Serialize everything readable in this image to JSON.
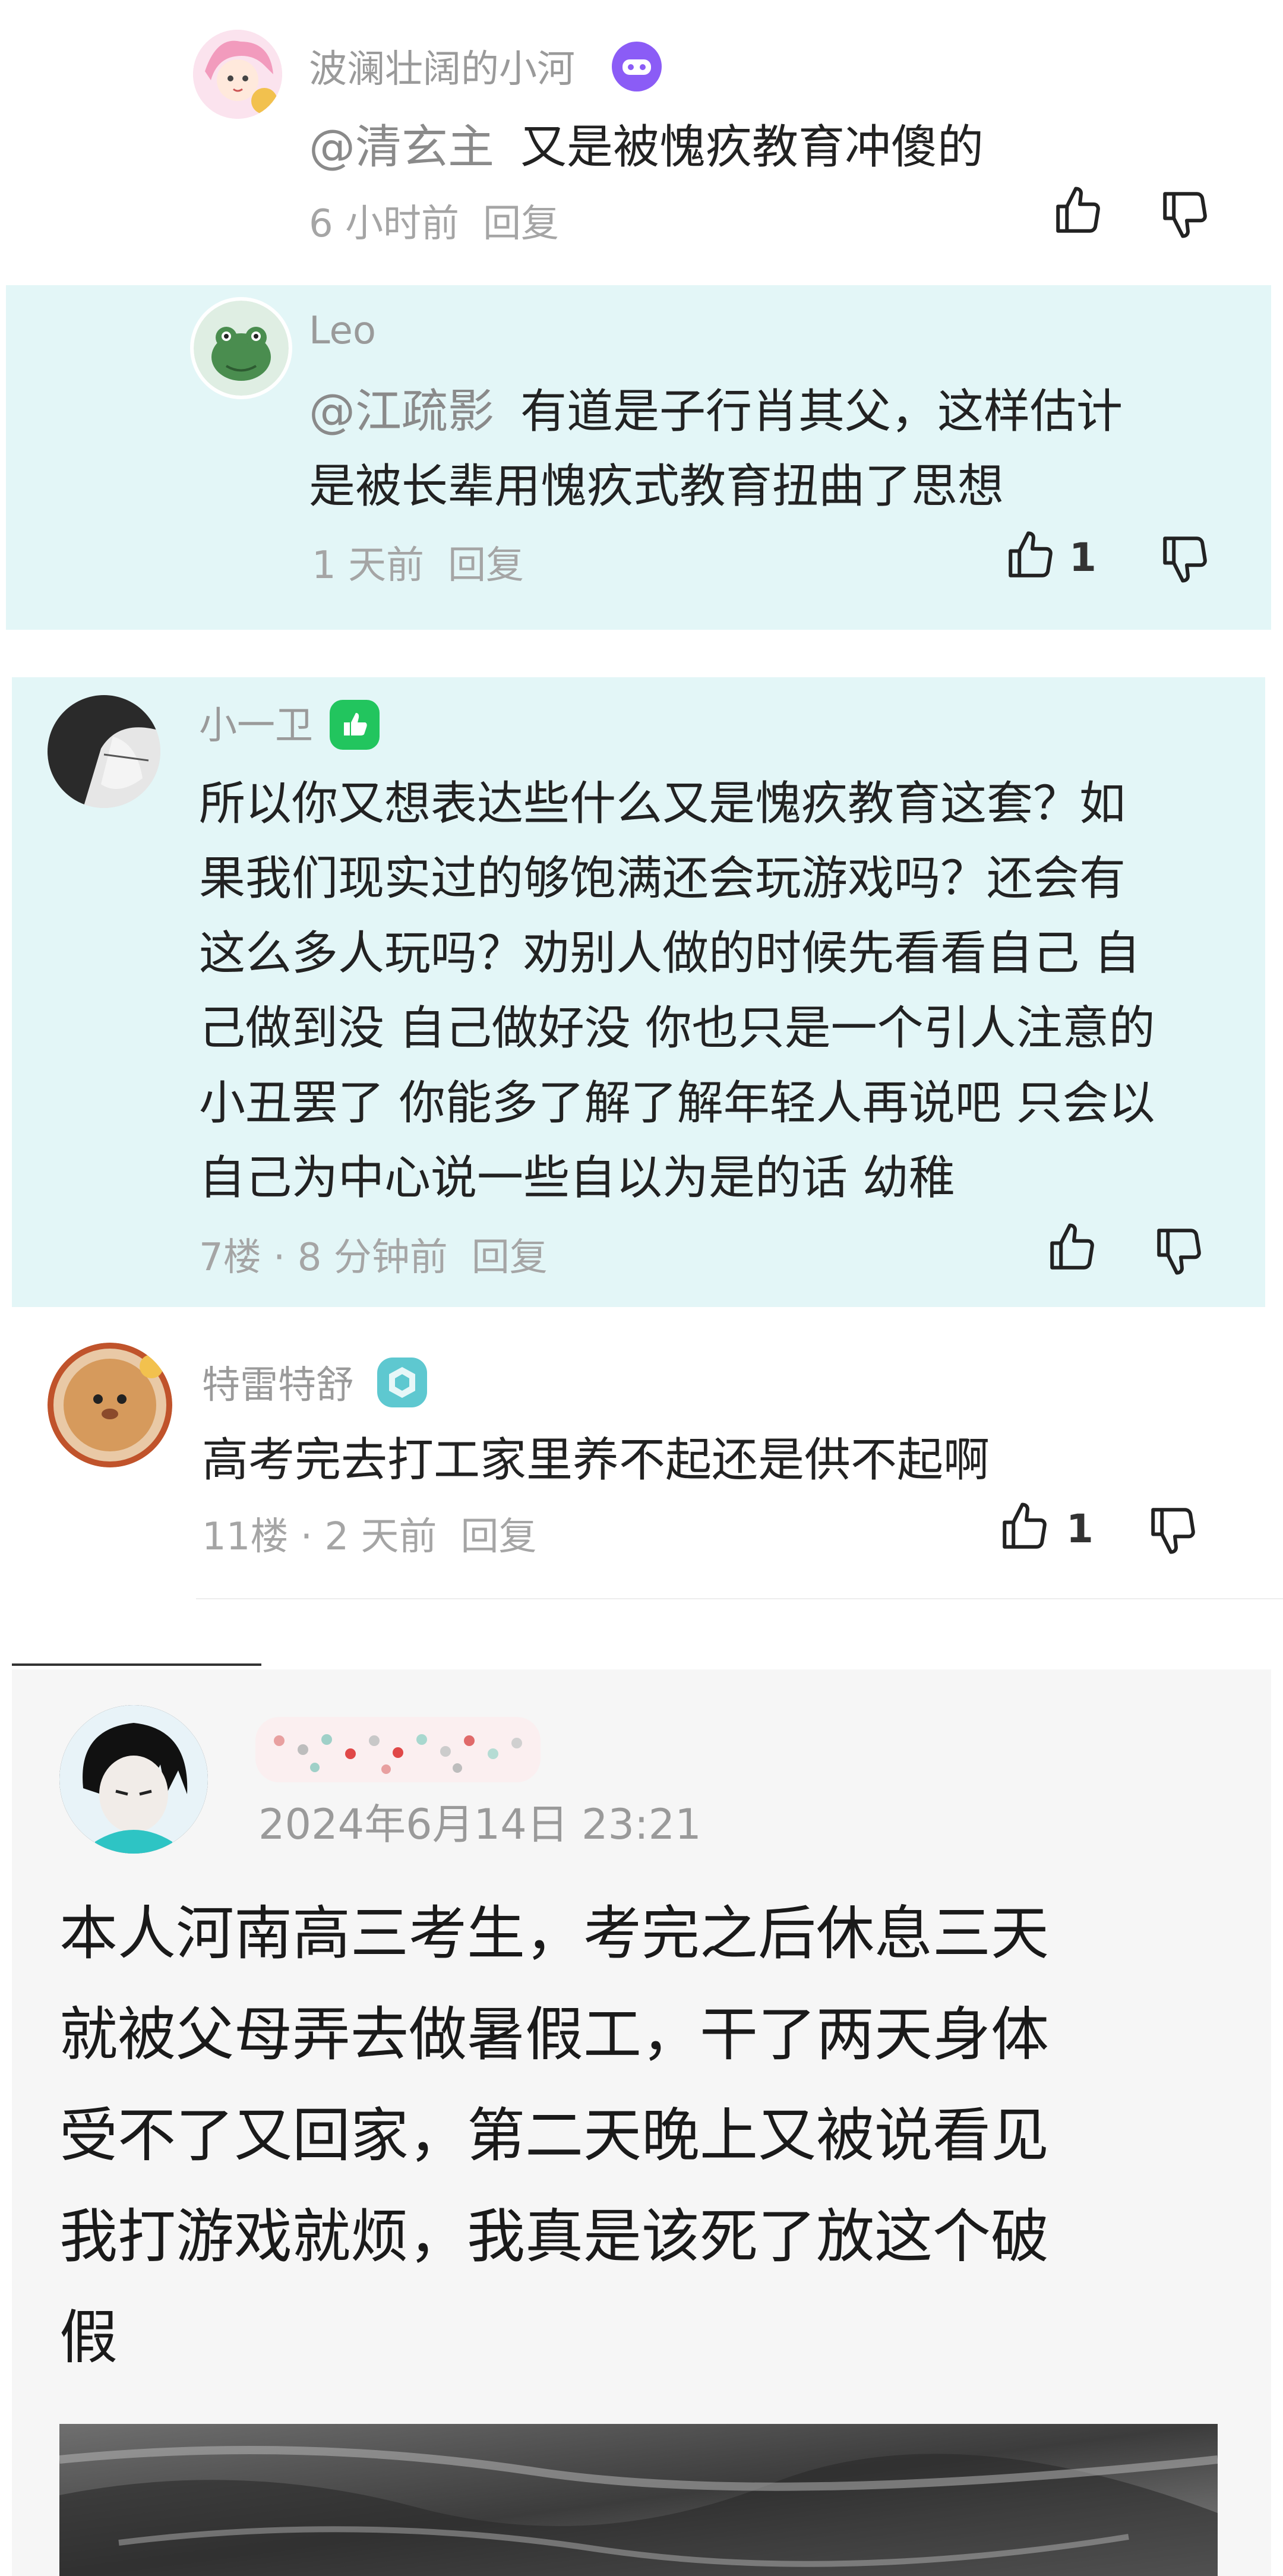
{
  "comments": [
    {
      "name": "波澜壮阔的小河",
      "mention": "@清玄主",
      "text": "又是被愧疚教育冲傻的",
      "time": "6 小时前",
      "reply": "回复"
    },
    {
      "name": "Leo",
      "mention": "@江疏影",
      "text_line1": "有道是子行肖其父，这样估计",
      "text_line2": "是被长辈用愧疚式教育扭曲了思想",
      "time": "1 天前",
      "reply": "回复",
      "likes": "1"
    },
    {
      "name": "小一卫",
      "lines": [
        "所以你又想表达些什么又是愧疚教育这套？如",
        "果我们现实过的够饱满还会玩游戏吗？还会有",
        "这么多人玩吗？劝别人做的时候先看看自己 自",
        "己做到没 自己做好没 你也只是一个引人注意的",
        "小丑罢了 你能多了解了解年轻人再说吧 只会以",
        "自己为中心说一些自以为是的话 幼稚"
      ],
      "floor_time": "7楼 · 8 分钟前",
      "reply": "回复"
    },
    {
      "name": "特雷特舒",
      "text": "高考完去打工家里养不起还是供不起啊",
      "floor_time": "11楼 · 2 天前",
      "reply": "回复",
      "likes": "1"
    }
  ],
  "post": {
    "date": "2024年6月14日 23:21",
    "lines": [
      "本人河南高三考生，考完之后休息三天",
      "就被父母弄去做暑假工，干了两天身体",
      "受不了又回家，第二天晚上又被说看见",
      "我打游戏就烦，我真是该死了放这个破",
      "假"
    ]
  },
  "colors": {
    "highlight_bg": "#e3f6f7",
    "name_gray": "#9a9a9a",
    "meta_gray": "#a5a5a5",
    "purple_badge": "#8b5cf6",
    "green_badge": "#22c55e",
    "teal_badge": "#5ec8d0"
  },
  "icons": [
    "thumb-up-icon",
    "thumb-down-icon",
    "game-badge-icon",
    "level-badge-icon"
  ]
}
